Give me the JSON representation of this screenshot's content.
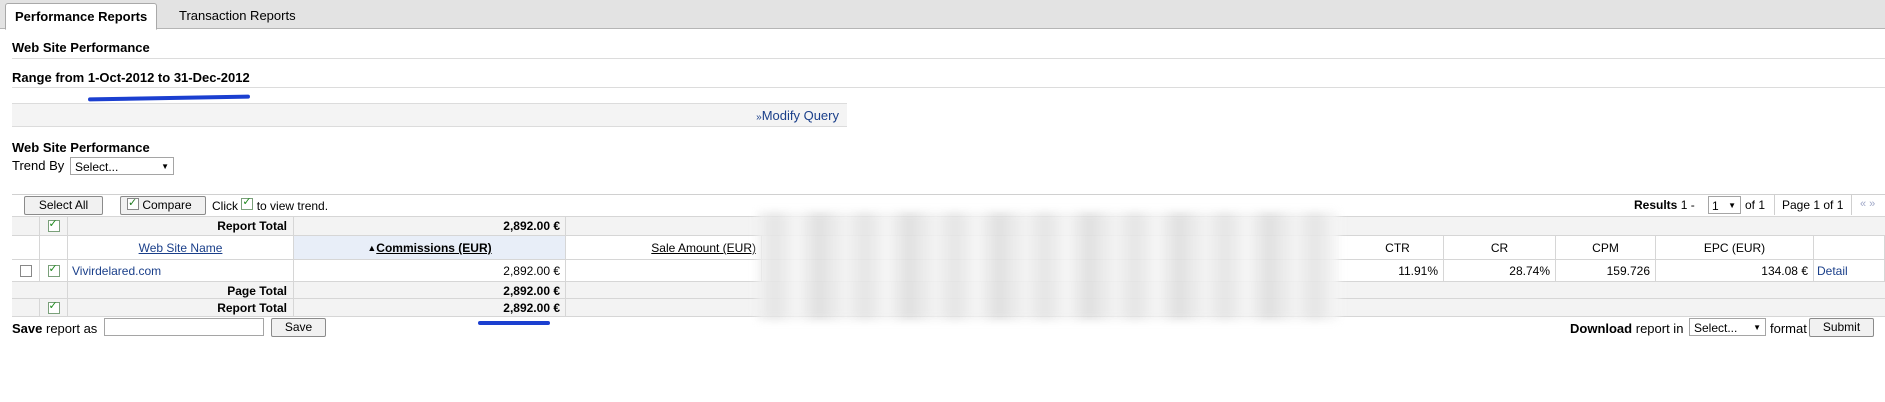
{
  "tabs": [
    {
      "label": "Performance Reports"
    },
    {
      "label": "Transaction Reports"
    }
  ],
  "section_title": "Web Site Performance",
  "range": {
    "label": "Range from 1-Oct-2012 to 31-Dec-2012"
  },
  "modify_query": "Modify Query",
  "trend": {
    "title": "Web Site Performance",
    "label": "Trend By",
    "select_value": "Select..."
  },
  "toolbar": {
    "select_all": "Select All",
    "compare": "Compare",
    "click_text_1": "Click",
    "click_text_2": "to view trend.",
    "results_label": "Results",
    "results_range": "1 -",
    "page_select": "1",
    "of_text": "of 1",
    "page_info": "Page 1 of 1",
    "pager": "« »"
  },
  "table": {
    "report_total_label": "Report Total",
    "report_total_value": "2,892.00 €",
    "headers": {
      "site_name": "Web Site Name",
      "commissions": "Commissions (EUR)",
      "sale_amount": "Sale Amount (EUR)",
      "ctr": "CTR",
      "cr": "CR",
      "cpm": "CPM",
      "epc": "EPC (EUR)"
    },
    "row": {
      "site": "Vivirdelared.com",
      "commissions": "2,892.00 €",
      "ctr": "11.91%",
      "cr": "28.74%",
      "cpm": "159.726",
      "epc": "134.08 €",
      "detail": "Detail"
    },
    "page_total_label": "Page Total",
    "page_total_value": "2,892.00 €",
    "report_total_bottom_label": "Report Total",
    "report_total_bottom_value": "2,892.00 €"
  },
  "save": {
    "label_bold": "Save",
    "label_rest": "report as",
    "input_value": "",
    "button": "Save"
  },
  "download": {
    "label_bold": "Download",
    "label_mid": "report in",
    "select_value": "Select...",
    "label_end": "format",
    "button": "Submit"
  },
  "colors": {
    "link": "#1a3f8a",
    "annotation_marker": "#1b3fd0"
  }
}
